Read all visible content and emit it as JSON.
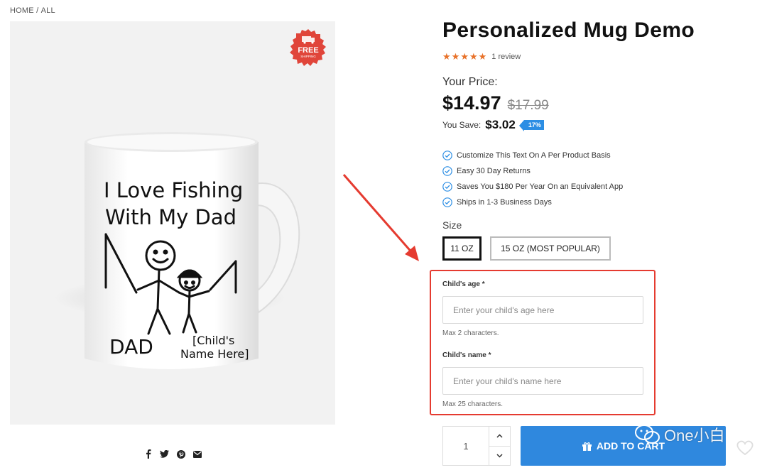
{
  "breadcrumb": {
    "home": "HOME",
    "separator": "/",
    "current": "ALL"
  },
  "badge": {
    "line1": "FREE",
    "line2": "SHIPPING",
    "color": "#e0453a"
  },
  "mug": {
    "line1": "I Love Fishing",
    "line2": "With My Dad",
    "dad_label": "DAD",
    "child_line1": "[Child's",
    "child_line2": "Name Here]"
  },
  "social": [
    "facebook-icon",
    "twitter-icon",
    "pinterest-icon",
    "email-icon"
  ],
  "product": {
    "title": "Personalized Mug Demo",
    "review_count": "1 review",
    "rating": 5,
    "price_label": "Your Price:",
    "price": "$14.97",
    "compare_price": "$17.99",
    "save_label": "You Save:",
    "save_amount": "$3.02",
    "save_percent": "17%",
    "accent_color": "#2c8ee4",
    "star_color": "#e8722a"
  },
  "benefits": [
    "Customize This Text On A Per Product Basis",
    "Easy 30 Day Returns",
    "Saves You $180 Per Year On an Equivalent App",
    "Ships in 1-3 Business Days"
  ],
  "size": {
    "label": "Size",
    "options": [
      "11 OZ",
      "15 OZ (MOST POPULAR)"
    ],
    "selected": "11 OZ"
  },
  "custom_fields": {
    "age": {
      "label": "Child's age *",
      "placeholder": "Enter your child's age here",
      "hint": "Max 2 characters."
    },
    "name": {
      "label": "Child's name *",
      "placeholder": "Enter your child's name here",
      "hint": "Max 25 characters."
    },
    "highlight_color": "#e53b30"
  },
  "cart": {
    "quantity": "1",
    "button_label": "ADD TO CART",
    "button_color": "#2f88de"
  },
  "watermark": {
    "text": "One小白"
  }
}
